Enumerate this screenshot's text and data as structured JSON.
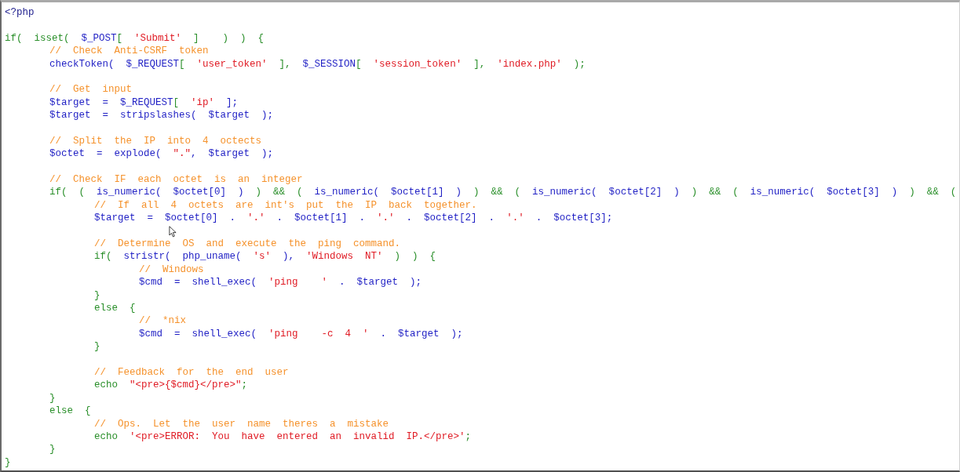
{
  "editor": {
    "lines": [
      {
        "kind": "code",
        "tokens": [
          {
            "kind": "tag",
            "text": "<?php"
          }
        ]
      },
      {
        "kind": "blank"
      },
      {
        "kind": "code",
        "tokens": [
          {
            "kind": "kw",
            "text": "if( isset( "
          },
          {
            "kind": "var",
            "text": "$_POST"
          },
          {
            "kind": "kw",
            "text": "[ "
          },
          {
            "kind": "str",
            "text": "'Submit'"
          },
          {
            "kind": "kw",
            "text": " ]  ) ) {"
          }
        ],
        "children": [
          {
            "kind": "code",
            "tokens": [
              {
                "kind": "cmt",
                "text": "// Check Anti-CSRF token"
              }
            ]
          },
          {
            "kind": "code",
            "tokens": [
              {
                "kind": "var",
                "text": "checkToken( $_REQUEST"
              },
              {
                "kind": "kw",
                "text": "[ "
              },
              {
                "kind": "str",
                "text": "'user_token'"
              },
              {
                "kind": "kw",
                "text": " ], "
              },
              {
                "kind": "var",
                "text": "$_SESSION"
              },
              {
                "kind": "kw",
                "text": "[ "
              },
              {
                "kind": "str",
                "text": "'session_token'"
              },
              {
                "kind": "kw",
                "text": " ], "
              },
              {
                "kind": "str",
                "text": "'index.php'"
              },
              {
                "kind": "kw",
                "text": " );"
              }
            ]
          },
          {
            "kind": "blank"
          },
          {
            "kind": "code",
            "tokens": [
              {
                "kind": "cmt",
                "text": "// Get input"
              }
            ]
          },
          {
            "kind": "code",
            "tokens": [
              {
                "kind": "var",
                "text": "$target = $_REQUEST"
              },
              {
                "kind": "kw",
                "text": "[ "
              },
              {
                "kind": "str",
                "text": "'ip'"
              },
              {
                "kind": "var",
                "text": " ];"
              }
            ]
          },
          {
            "kind": "code",
            "tokens": [
              {
                "kind": "var",
                "text": "$target = stripslashes( $target );"
              }
            ]
          },
          {
            "kind": "blank"
          },
          {
            "kind": "code",
            "tokens": [
              {
                "kind": "cmt",
                "text": "// Split the IP into 4 octects"
              }
            ]
          },
          {
            "kind": "code",
            "tokens": [
              {
                "kind": "var",
                "text": "$octet = explode( "
              },
              {
                "kind": "str",
                "text": "\".\""
              },
              {
                "kind": "var",
                "text": ", $target );"
              }
            ]
          },
          {
            "kind": "blank"
          },
          {
            "kind": "code",
            "tokens": [
              {
                "kind": "cmt",
                "text": "// Check IF each octet is an integer"
              }
            ]
          },
          {
            "kind": "code",
            "tokens": [
              {
                "kind": "kw",
                "text": "if( ( "
              },
              {
                "kind": "var",
                "text": "is_numeric( $octet[0] ) "
              },
              {
                "kind": "kw",
                "text": ") && ( "
              },
              {
                "kind": "var",
                "text": "is_numeric( $octet[1] ) "
              },
              {
                "kind": "kw",
                "text": ") && ( "
              },
              {
                "kind": "var",
                "text": "is_numeric( $octet[2] ) "
              },
              {
                "kind": "kw",
                "text": ") && ( "
              },
              {
                "kind": "var",
                "text": "is_numeric( $octet[3] ) "
              },
              {
                "kind": "kw",
                "text": ") && ("
              }
            ],
            "children": [
              {
                "kind": "code",
                "tokens": [
                  {
                    "kind": "cmt",
                    "text": "// If all 4 octets are int's put the IP back together."
                  }
                ]
              },
              {
                "kind": "code",
                "tokens": [
                  {
                    "kind": "var",
                    "text": "$target = $octet[0] . "
                  },
                  {
                    "kind": "str",
                    "text": "'.'"
                  },
                  {
                    "kind": "var",
                    "text": " . $octet[1] . "
                  },
                  {
                    "kind": "str",
                    "text": "'.'"
                  },
                  {
                    "kind": "var",
                    "text": " . $octet[2] . "
                  },
                  {
                    "kind": "str",
                    "text": "'.'"
                  },
                  {
                    "kind": "var",
                    "text": " . $octet[3];"
                  }
                ]
              },
              {
                "kind": "blank"
              },
              {
                "kind": "code",
                "tokens": [
                  {
                    "kind": "cmt",
                    "text": "// Determine OS and execute the ping command."
                  }
                ]
              },
              {
                "kind": "code",
                "tokens": [
                  {
                    "kind": "kw",
                    "text": "if( "
                  },
                  {
                    "kind": "var",
                    "text": "stristr( php_uname( "
                  },
                  {
                    "kind": "str",
                    "text": "'s'"
                  },
                  {
                    "kind": "var",
                    "text": " ), "
                  },
                  {
                    "kind": "str",
                    "text": "'Windows NT'"
                  },
                  {
                    "kind": "kw",
                    "text": " ) ) {"
                  }
                ],
                "children": [
                  {
                    "kind": "code",
                    "tokens": [
                      {
                        "kind": "cmt",
                        "text": "// Windows"
                      }
                    ]
                  },
                  {
                    "kind": "code",
                    "tokens": [
                      {
                        "kind": "var",
                        "text": "$cmd = shell_exec( "
                      },
                      {
                        "kind": "str",
                        "text": "'ping  '"
                      },
                      {
                        "kind": "var",
                        "text": " . $target );"
                      }
                    ]
                  }
                ]
              },
              {
                "kind": "code",
                "tokens": [
                  {
                    "kind": "kw",
                    "text": "}"
                  }
                ]
              },
              {
                "kind": "code",
                "tokens": [
                  {
                    "kind": "kw",
                    "text": "else {"
                  }
                ],
                "children": [
                  {
                    "kind": "code",
                    "tokens": [
                      {
                        "kind": "cmt",
                        "text": "// *nix"
                      }
                    ]
                  },
                  {
                    "kind": "code",
                    "tokens": [
                      {
                        "kind": "var",
                        "text": "$cmd = shell_exec( "
                      },
                      {
                        "kind": "str",
                        "text": "'ping  -c 4 '"
                      },
                      {
                        "kind": "var",
                        "text": " . $target );"
                      }
                    ]
                  }
                ]
              },
              {
                "kind": "code",
                "tokens": [
                  {
                    "kind": "kw",
                    "text": "}"
                  }
                ]
              },
              {
                "kind": "blank"
              },
              {
                "kind": "code",
                "tokens": [
                  {
                    "kind": "cmt",
                    "text": "// Feedback for the end user"
                  }
                ]
              },
              {
                "kind": "code",
                "tokens": [
                  {
                    "kind": "kw",
                    "text": "echo "
                  },
                  {
                    "kind": "str",
                    "text": "\"<pre>{$cmd}</pre>\""
                  },
                  {
                    "kind": "kw",
                    "text": ";"
                  }
                ]
              }
            ]
          },
          {
            "kind": "code",
            "tokens": [
              {
                "kind": "kw",
                "text": "}"
              }
            ]
          },
          {
            "kind": "code",
            "tokens": [
              {
                "kind": "kw",
                "text": "else {"
              }
            ],
            "children": [
              {
                "kind": "code",
                "tokens": [
                  {
                    "kind": "cmt",
                    "text": "// Ops. Let the user name theres a mistake"
                  }
                ]
              },
              {
                "kind": "code",
                "tokens": [
                  {
                    "kind": "kw",
                    "text": "echo "
                  },
                  {
                    "kind": "str",
                    "text": "'<pre>ERROR: You have entered an invalid IP.</pre>'"
                  },
                  {
                    "kind": "kw",
                    "text": ";"
                  }
                ]
              }
            ]
          },
          {
            "kind": "code",
            "tokens": [
              {
                "kind": "kw",
                "text": "}"
              }
            ]
          }
        ]
      },
      {
        "kind": "code",
        "tokens": [
          {
            "kind": "kw",
            "text": "}"
          }
        ]
      }
    ]
  }
}
